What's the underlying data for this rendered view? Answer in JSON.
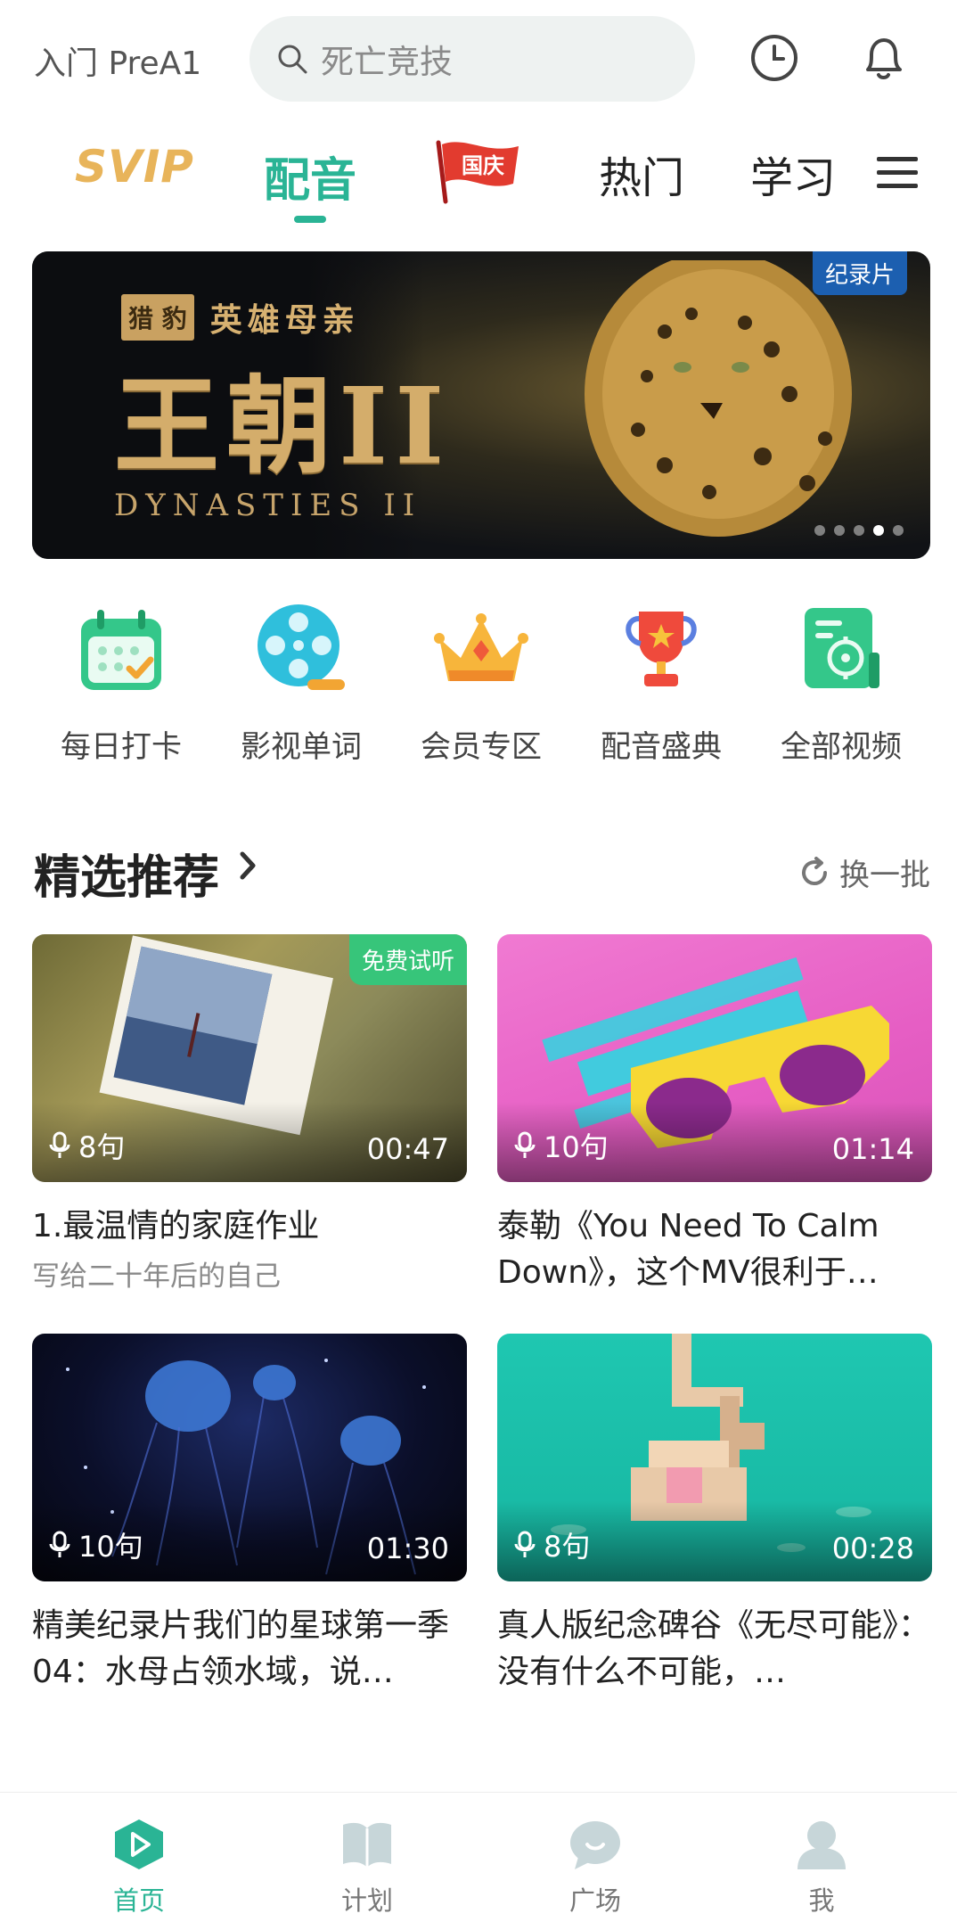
{
  "header": {
    "level": "入门 PreA1",
    "search_placeholder": "死亡竞技"
  },
  "tabs": {
    "svip": "SVIP",
    "dubbing": "配音",
    "national_day": "国庆",
    "hot": "热门",
    "study": "学习"
  },
  "banner": {
    "seal": "猎 豹",
    "subtitle": "英雄母亲",
    "title": "王朝II",
    "title_en": "DYNASTIES II",
    "badge": "纪录片",
    "slide_count": 5,
    "active_slide": 4
  },
  "quick": [
    {
      "label": "每日打卡",
      "icon": "calendar-check-icon"
    },
    {
      "label": "影视单词",
      "icon": "film-reel-icon"
    },
    {
      "label": "会员专区",
      "icon": "crown-icon"
    },
    {
      "label": "配音盛典",
      "icon": "trophy-icon"
    },
    {
      "label": "全部视频",
      "icon": "video-list-icon"
    }
  ],
  "section": {
    "title": "精选推荐",
    "refresh": "换一批"
  },
  "cards": [
    {
      "count": "8句",
      "duration": "00:47",
      "title": "1.最温情的家庭作业",
      "subtitle": "写给二十年后的自己",
      "badge": "免费试听"
    },
    {
      "count": "10句",
      "duration": "01:14",
      "title": "泰勒《You Need To Calm Down》，这个MV很利于…"
    },
    {
      "count": "10句",
      "duration": "01:30",
      "title": "精美纪录片我们的星球第一季04：水母占领水域，说…"
    },
    {
      "count": "8句",
      "duration": "00:28",
      "title": "真人版纪念碑谷《无尽可能》：没有什么不可能，…"
    }
  ],
  "nav": {
    "home": "首页",
    "plan": "计划",
    "square": "广场",
    "me": "我"
  },
  "colors": {
    "accent": "#2ab495",
    "svip": "#e8b45a",
    "free_badge": "#37c57a",
    "doc_badge": "#1c5fb0"
  }
}
